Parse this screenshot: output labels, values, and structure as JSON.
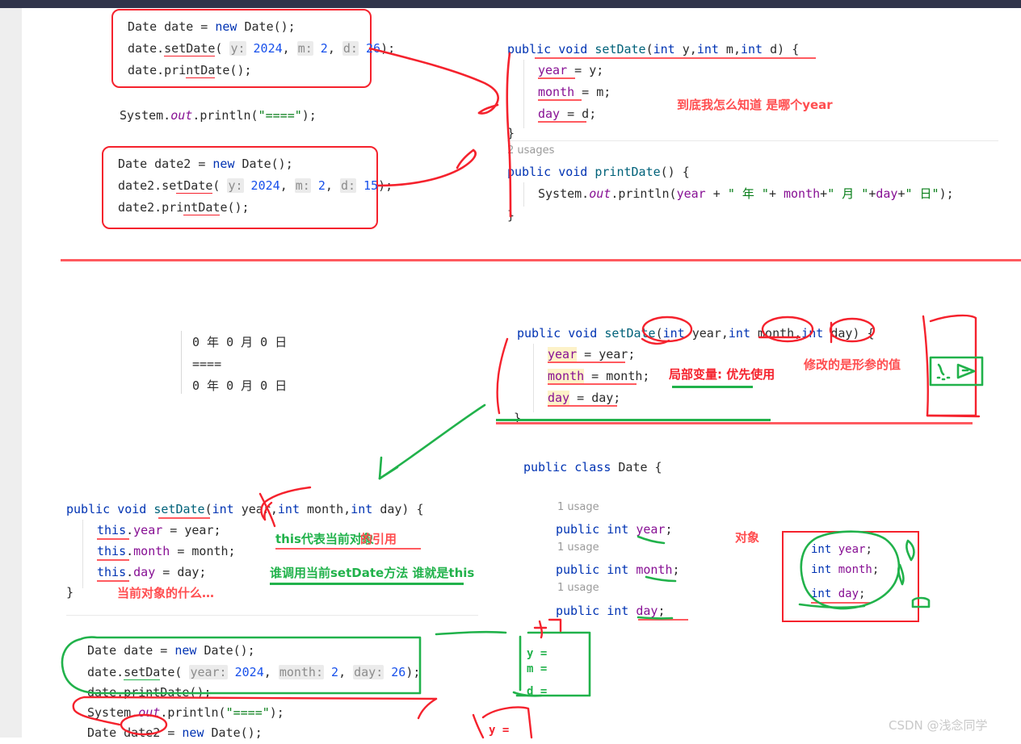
{
  "watermark": "CSDN @浅念同学",
  "section_top": {
    "block_date1": {
      "lines": [
        "Date date = new Date();",
        "date.setDate( y: 2024, m: 2, d: 26);",
        "date.printDate();"
      ]
    },
    "println_divider": "System.out.println(\"====\");",
    "block_date2": {
      "lines": [
        "Date date2 = new Date();",
        "date2.setDate( y: 2024, m: 2, d: 15);",
        "date2.printDate();"
      ]
    },
    "setdate_method": {
      "signature": "public void setDate(int y,int m,int d) {",
      "body": [
        "year = y;",
        "month = m;",
        "day = d;"
      ],
      "close": "}"
    },
    "printdate_method": {
      "usages": "2 usages",
      "signature": "public void printDate() {",
      "body": "System.out.println(year + \" 年 \"+ month+\" 月 \"+day+\" 日\");",
      "close": "}"
    },
    "annotation_which_year": "到底我怎么知道 是哪个year"
  },
  "section_mid": {
    "console_output": [
      "0 年 0 月 0 日",
      "====",
      "0 年 0 月 0 日"
    ],
    "setdate_shadowed": {
      "signature": "public void setDate(int year,int month,int day) {",
      "body": [
        "year = year;",
        "month = month;",
        "day = day;"
      ],
      "close": "}"
    },
    "annotation_local_var": "局部变量: 优先使用",
    "annotation_modify_param": "修改的是形参的值"
  },
  "section_bottom": {
    "setdate_this": {
      "signature": "public void setDate(int year,int month,int day) {",
      "body": [
        "this.year = year;",
        "this.month = month;",
        "this.day = day;"
      ],
      "close": "}"
    },
    "annotation_this_ref_a": "this代表当前对象",
    "annotation_this_ref_b": "的引用",
    "annotation_who_calls": "谁调用当前setDate方法 谁就是this",
    "annotation_current_obj": "当前对象的什么…",
    "date_class": {
      "signature": "public class Date {",
      "usage_label": "1 usage",
      "fields": [
        "public int year;",
        "public int month;",
        "public int day;"
      ]
    },
    "annotation_object": "对象",
    "object_box_fields": [
      "int year;",
      "int month;",
      "int day;"
    ],
    "main_block": {
      "lines": [
        "Date date = new Date();",
        "date.setDate( year: 2024, month: 2, day: 26);",
        "date.printDate();",
        "System.out.println(\"====\");",
        "Date date2 = new Date();"
      ]
    },
    "sketch_vars": [
      "y =",
      "m =",
      "d ="
    ],
    "sketch_y_equals": "y ="
  },
  "colors": {
    "red_ink": "#f5222d",
    "green_ink": "#21b24b",
    "topbar": "#30344a",
    "left_strip": "#eeeeee",
    "keyword": "#0033b3",
    "number": "#1750eb",
    "string": "#067d17",
    "field": "#871094",
    "method": "#00627a"
  }
}
